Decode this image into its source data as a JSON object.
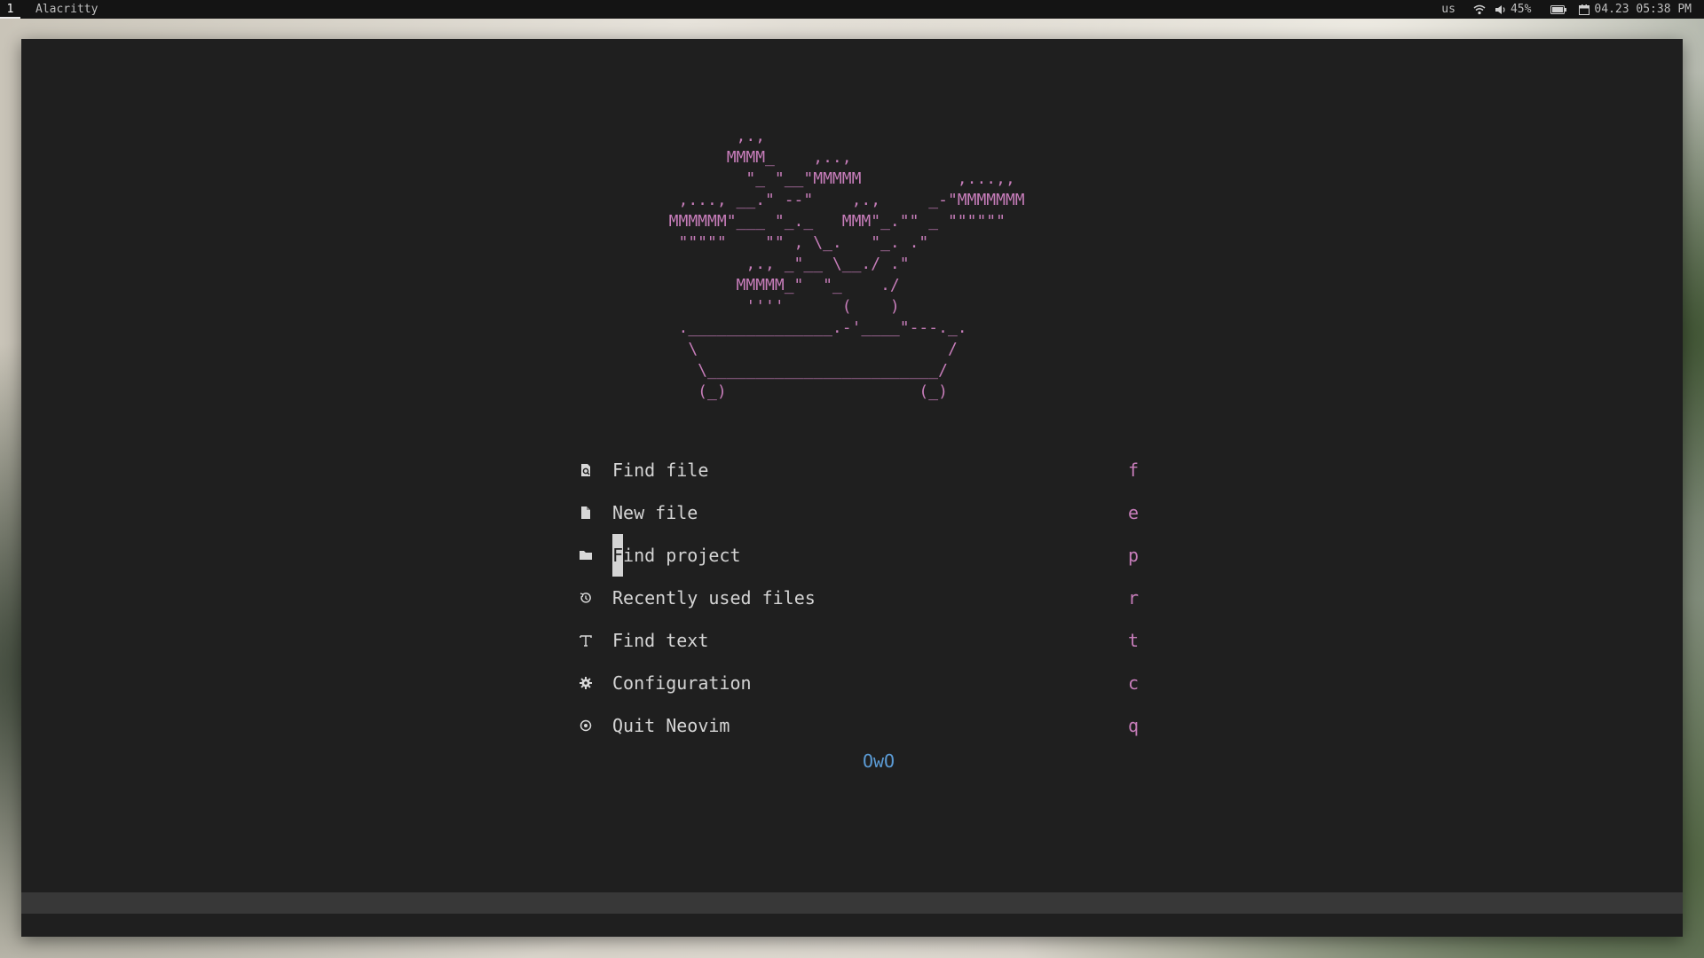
{
  "topbar": {
    "workspace": "1",
    "window_title": "Alacritty",
    "keyboard_layout": "us",
    "volume": "45%",
    "datetime": "04.23 05:38 PM"
  },
  "dashboard": {
    "ascii_art": "         ,.,\n        MMMM_    ,..,\n          \"_ \"__\"MMMMM          ,...,,\n   ,..., __.\" --\"    ,.,     _-\"MMMMMMM\n  MMMMMM\"___ \"_._   MMM\"_.\"\" _ \"\"\"\"\"\"\n   \"\"\"\"\"    \"\" , \\_.   \"_. .\"\n          ,., _\"__ \\__./ .\"\n         MMMMM_\"  \"_    ./\n          ''''      (    )\n   ._______________.-'____\"---._.\n    \\                          /\n     \\________________________/\n     (_)                    (_)",
    "menu": [
      {
        "icon": "search-file-icon",
        "label": "Find file",
        "key": "f"
      },
      {
        "icon": "new-file-icon",
        "label": "New file",
        "key": "e"
      },
      {
        "icon": "folder-icon",
        "label": "Find project",
        "key": "p",
        "cursor_char": "F",
        "label_rest": "ind project"
      },
      {
        "icon": "history-icon",
        "label": "Recently used files",
        "key": "r"
      },
      {
        "icon": "text-icon",
        "label": "Find text",
        "key": "t"
      },
      {
        "icon": "gear-icon",
        "label": "Configuration",
        "key": "c"
      },
      {
        "icon": "quit-icon",
        "label": "Quit Neovim",
        "key": "q"
      }
    ],
    "footer": "OwO"
  },
  "colors": {
    "accent_pink": "#c77dba",
    "footer_blue": "#5b9bd5",
    "terminal_bg": "#1f1f1f"
  }
}
